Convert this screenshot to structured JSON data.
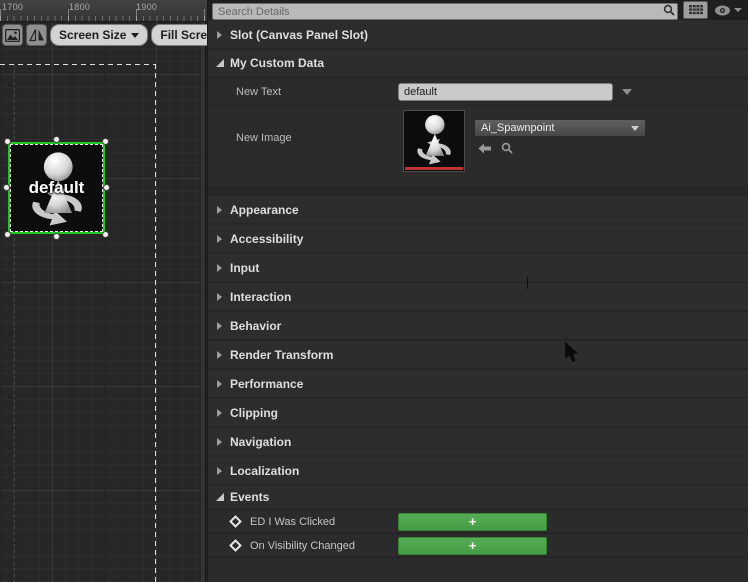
{
  "designer": {
    "ruler": {
      "labels": [
        "1700",
        "1800",
        "1900"
      ]
    },
    "toolbar": {
      "screen_size": "Screen Size",
      "fill_screen": "Fill Screen"
    },
    "canvas": {
      "widget_label": "default"
    }
  },
  "details": {
    "search_placeholder": "Search Details",
    "slot_section": "Slot (Canvas Panel Slot)",
    "custom_data_section": "My Custom Data",
    "properties": {
      "new_text": {
        "label": "New Text",
        "value": "default"
      },
      "new_image": {
        "label": "New Image",
        "asset": "Ai_Spawnpoint"
      }
    },
    "categories": [
      "Appearance",
      "Accessibility",
      "Input",
      "Interaction",
      "Behavior",
      "Render Transform",
      "Performance",
      "Clipping",
      "Navigation",
      "Localization"
    ],
    "events_section": "Events",
    "events": [
      {
        "label": "ED I Was Clicked",
        "button": "+"
      },
      {
        "label": "On Visibility Changed",
        "button": "+"
      }
    ],
    "colors": {
      "selection_green": "#1ecb1e",
      "button_green": "#4aa74a",
      "asset_bar_red": "#bf3434"
    }
  }
}
